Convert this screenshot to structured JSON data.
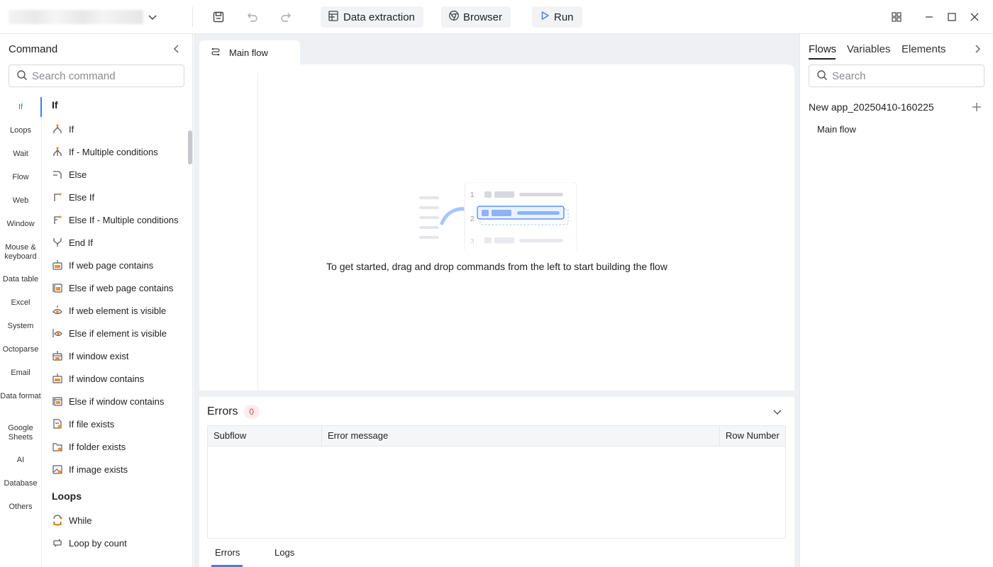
{
  "topbar": {
    "data_extraction_label": "Data extraction",
    "browser_label": "Browser",
    "run_label": "Run"
  },
  "left_panel": {
    "title": "Command",
    "search_placeholder": "Search command",
    "categories": [
      "If",
      "Loops",
      "Wait",
      "Flow",
      "Web",
      "Window",
      "Mouse & keyboard",
      "Data table",
      "Excel",
      "System",
      "Octoparse",
      "Email",
      "Data format",
      "Google Sheets",
      "AI",
      "Database",
      "Others"
    ],
    "active_category": "If",
    "groups": [
      {
        "title": "If",
        "items": [
          {
            "label": "If",
            "icon": "branch-icon"
          },
          {
            "label": "If - Multiple conditions",
            "icon": "multi-branch-icon"
          },
          {
            "label": "Else",
            "icon": "else-icon"
          },
          {
            "label": "Else If",
            "icon": "else-if-icon"
          },
          {
            "label": "Else If - Multiple conditions",
            "icon": "else-if-multi-icon"
          },
          {
            "label": "End If",
            "icon": "end-if-icon"
          },
          {
            "label": "If web page contains",
            "icon": "web-page-contains-icon"
          },
          {
            "label": "Else if web page contains",
            "icon": "else-web-page-contains-icon"
          },
          {
            "label": "If web element is visible",
            "icon": "web-element-visible-icon"
          },
          {
            "label": "Else if element is visible",
            "icon": "else-element-visible-icon"
          },
          {
            "label": "If window exist",
            "icon": "window-exist-icon"
          },
          {
            "label": "If window contains",
            "icon": "window-contains-icon"
          },
          {
            "label": "Else if window contains",
            "icon": "else-window-contains-icon"
          },
          {
            "label": "If file exists",
            "icon": "file-exists-icon"
          },
          {
            "label": "If folder exists",
            "icon": "folder-exists-icon"
          },
          {
            "label": "If image exists",
            "icon": "image-exists-icon"
          }
        ]
      },
      {
        "title": "Loops",
        "items": [
          {
            "label": "While",
            "icon": "while-loop-icon"
          },
          {
            "label": "Loop by count",
            "icon": "loop-count-icon"
          }
        ]
      }
    ]
  },
  "center": {
    "tab_label": "Main flow",
    "empty_message": "To get started, drag and drop commands from the left to start building the flow",
    "illustration_rows": [
      "1",
      "2",
      "3"
    ],
    "errors": {
      "title": "Errors",
      "count": "0",
      "columns": [
        "Subflow",
        "Error message",
        "Row Number"
      ],
      "bottom_tabs": [
        "Errors",
        "Logs"
      ]
    }
  },
  "right_panel": {
    "tabs": [
      "Flows",
      "Variables",
      "Elements"
    ],
    "search_placeholder": "Search",
    "app_name": "New app_20250410-160225",
    "flows": [
      "Main flow"
    ]
  },
  "colors": {
    "accent": "#3f7cf6",
    "icon_orange": "#f0902b",
    "icon_gray": "#5a5d66",
    "canvas_bg": "#eef0f4",
    "error_badge": "#e14b4b"
  }
}
